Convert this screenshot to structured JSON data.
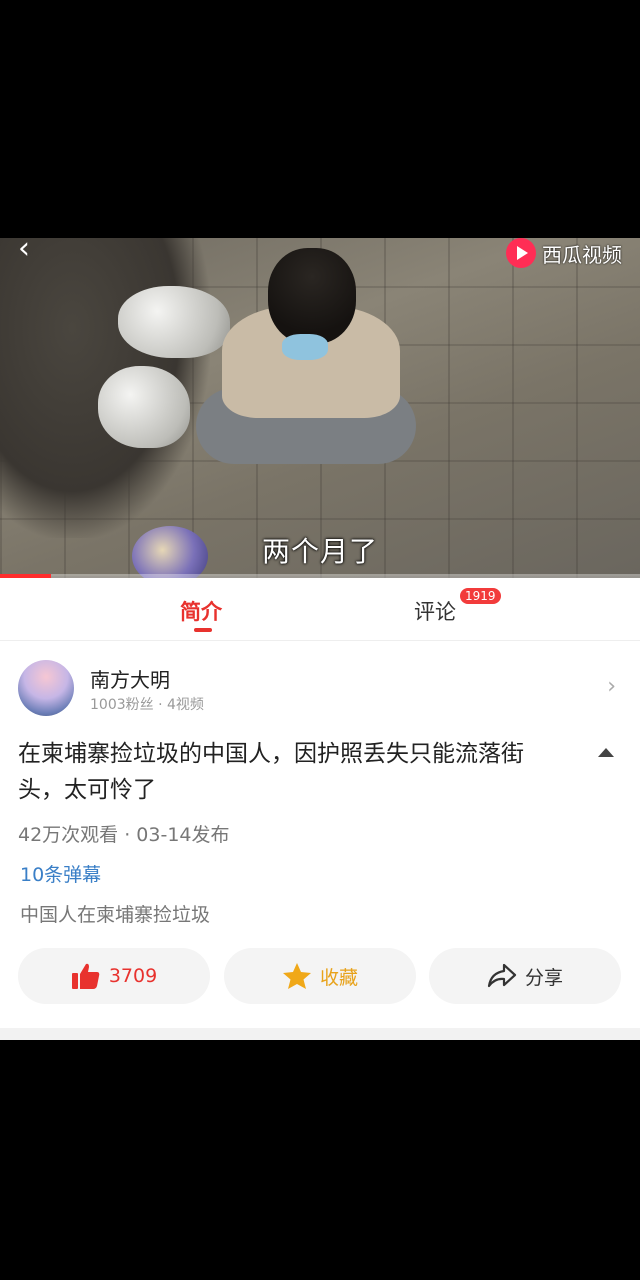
{
  "video": {
    "subtitle": "两个月了",
    "brand": "西瓜视频",
    "progress": 0.08
  },
  "tabs": {
    "intro": "简介",
    "comments": "评论",
    "comment_count": "1919"
  },
  "author": {
    "name": "南方大明",
    "meta": "1003粉丝 · 4视频"
  },
  "post": {
    "title": "在柬埔寨捡垃圾的中国人，因护照丢失只能流落街头，太可怜了",
    "stats": "42万次观看 · 03-14发布",
    "danmu": "10条弹幕",
    "tag": "中国人在柬埔寨捡垃圾"
  },
  "actions": {
    "like_count": "3709",
    "favorite_label": "收藏",
    "share_label": "分享"
  },
  "colors": {
    "accent": "#e8322e",
    "link": "#3a7fc7",
    "favorite": "#e8a21a"
  }
}
